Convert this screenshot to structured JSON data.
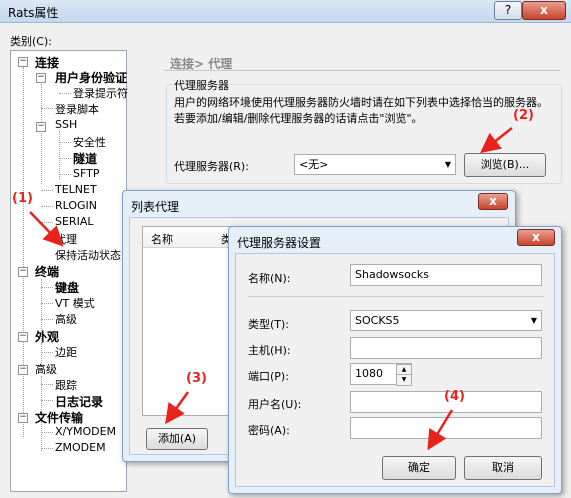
{
  "main_window": {
    "title": "Rats属性",
    "help_glyph": "?",
    "close_glyph": "x",
    "category_label": "类别(C):",
    "breadcrumb": "连接> 代理",
    "proxy_group_title": "代理服务器",
    "proxy_description": "用户的网络环境使用代理服务器防火墙时请在如下列表中选择恰当的服务器。若要添加/编辑/删除代理服务器的话请点击\"浏览\"。",
    "proxy_server_label": "代理服务器(R):",
    "proxy_server_value": "<无>",
    "browse_button": "浏览(B)..."
  },
  "tree": {
    "items": [
      {
        "label": "连接",
        "bold": true
      },
      {
        "label": "用户身份验证",
        "bold": true
      },
      {
        "label": "登录提示符",
        "bold": false
      },
      {
        "label": "登录脚本",
        "bold": false
      },
      {
        "label": "SSH",
        "bold": false
      },
      {
        "label": "安全性",
        "bold": false
      },
      {
        "label": "隧道",
        "bold": true
      },
      {
        "label": "SFTP",
        "bold": false
      },
      {
        "label": "TELNET",
        "bold": false
      },
      {
        "label": "RLOGIN",
        "bold": false
      },
      {
        "label": "SERIAL",
        "bold": false
      },
      {
        "label": "代理",
        "bold": false
      },
      {
        "label": "保持活动状态",
        "bold": false
      },
      {
        "label": "终端",
        "bold": true
      },
      {
        "label": "键盘",
        "bold": true
      },
      {
        "label": "VT 模式",
        "bold": false
      },
      {
        "label": "高级",
        "bold": false
      },
      {
        "label": "外观",
        "bold": true
      },
      {
        "label": "边距",
        "bold": false
      },
      {
        "label": "高级",
        "bold": false
      },
      {
        "label": "跟踪",
        "bold": false
      },
      {
        "label": "日志记录",
        "bold": true
      },
      {
        "label": "文件传输",
        "bold": true
      },
      {
        "label": "X/YMODEM",
        "bold": false
      },
      {
        "label": "ZMODEM",
        "bold": false
      }
    ]
  },
  "list_dialog": {
    "title": "列表代理",
    "col_name": "名称",
    "col_type": "类",
    "add_button": "添加(A)",
    "close_glyph": "x"
  },
  "settings_dialog": {
    "title": "代理服务器设置",
    "close_glyph": "x",
    "name_label": "名称(N):",
    "name_value": "Shadowsocks",
    "type_label": "类型(T):",
    "type_value": "SOCKS5",
    "host_label": "主机(H):",
    "host_value": "",
    "port_label": "端口(P):",
    "port_value": "1080",
    "user_label": "用户名(U):",
    "user_value": "",
    "password_label": "密码(A):",
    "password_value": "",
    "ok_button": "确定",
    "cancel_button": "取消"
  },
  "annotations": {
    "c1": "(1)",
    "c2": "(2)",
    "c3": "(3)",
    "c4": "(4)",
    "color": "#e8231c"
  }
}
